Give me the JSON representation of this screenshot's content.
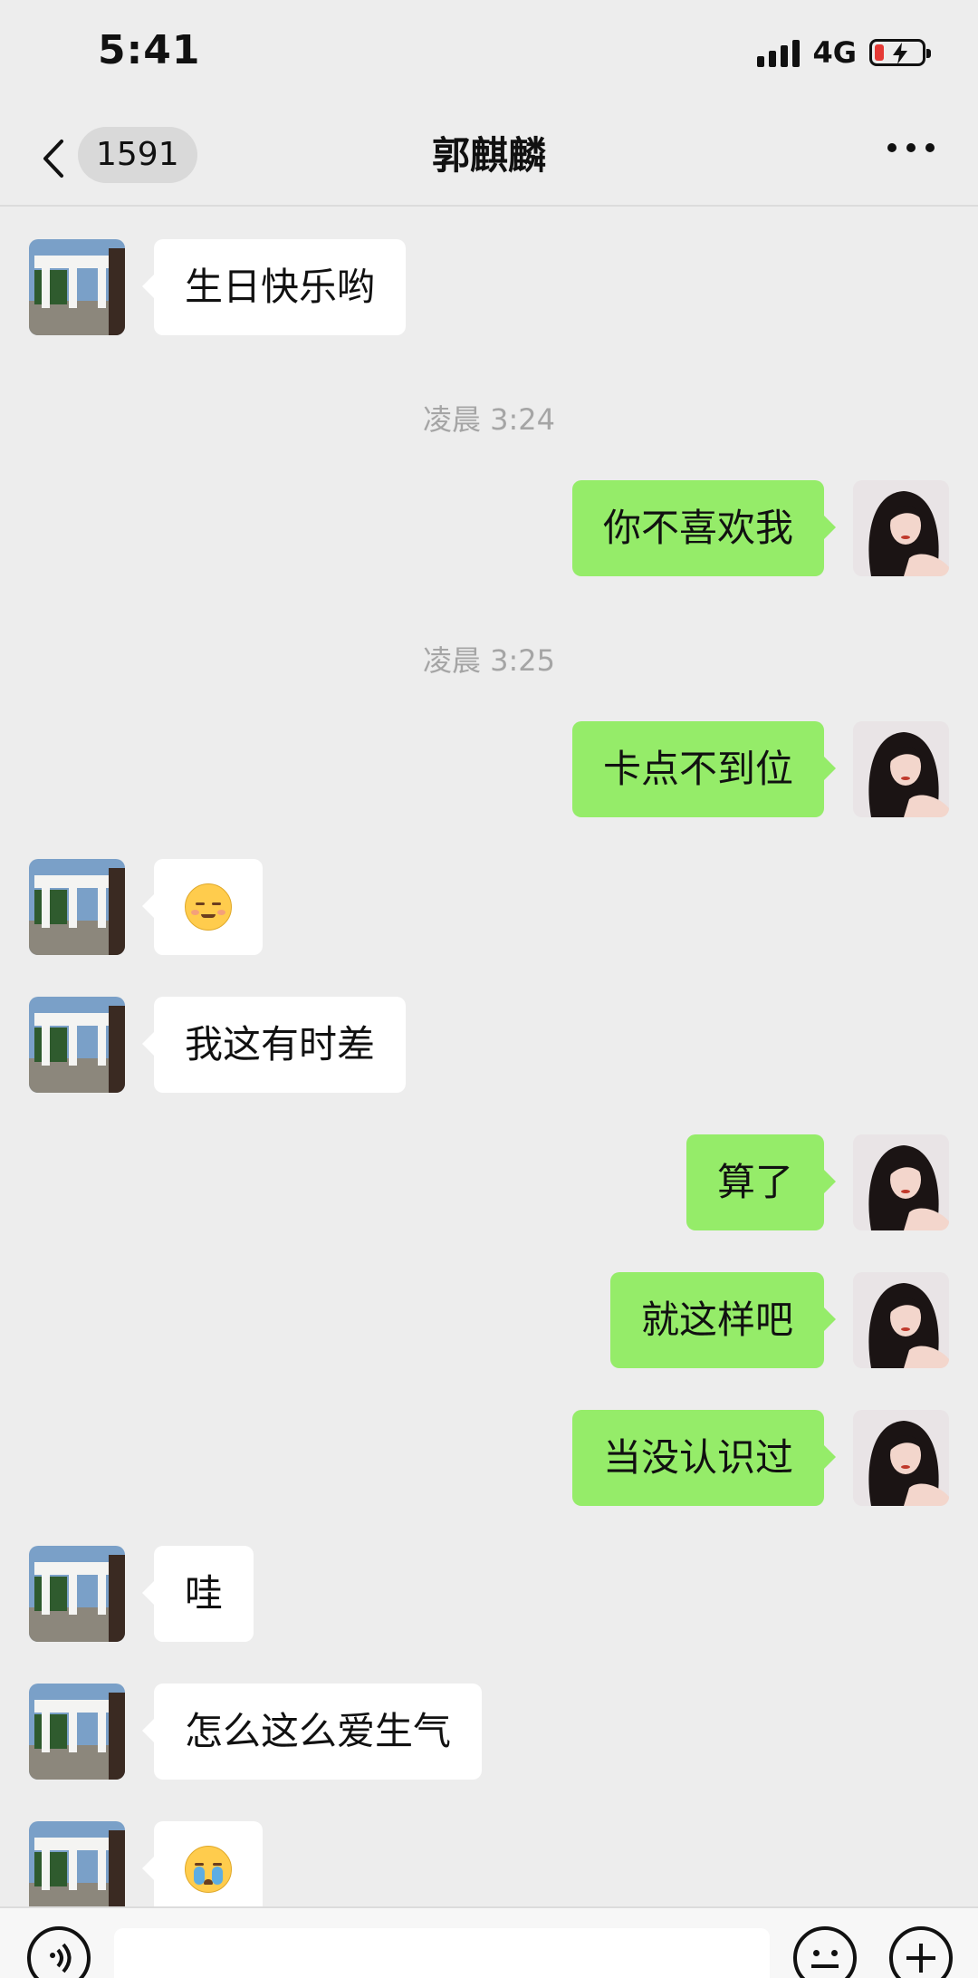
{
  "status_bar": {
    "time": "5:41",
    "network": "4G"
  },
  "nav": {
    "unread_count": "1591",
    "title": "郭麒麟"
  },
  "messages": [
    {
      "side": "in",
      "text": "生日快乐哟"
    },
    {
      "type": "time",
      "text": "凌晨 3:24"
    },
    {
      "side": "out",
      "text": "你不喜欢我"
    },
    {
      "type": "time",
      "text": "凌晨 3:25"
    },
    {
      "side": "out",
      "text": "卡点不到位"
    },
    {
      "side": "in",
      "emoji": "smiling-face-emoji"
    },
    {
      "side": "in",
      "text": "我这有时差"
    },
    {
      "side": "out",
      "text": "算了"
    },
    {
      "side": "out",
      "text": "就这样吧"
    },
    {
      "side": "out",
      "text": "当没认识过"
    },
    {
      "side": "in",
      "text": "哇"
    },
    {
      "side": "in",
      "text": "怎么这么爱生气"
    },
    {
      "side": "in",
      "emoji": "crying-face-emoji"
    }
  ],
  "colors": {
    "outgoing_bubble": "#95ec69",
    "incoming_bubble": "#ffffff",
    "background": "#ededed"
  }
}
